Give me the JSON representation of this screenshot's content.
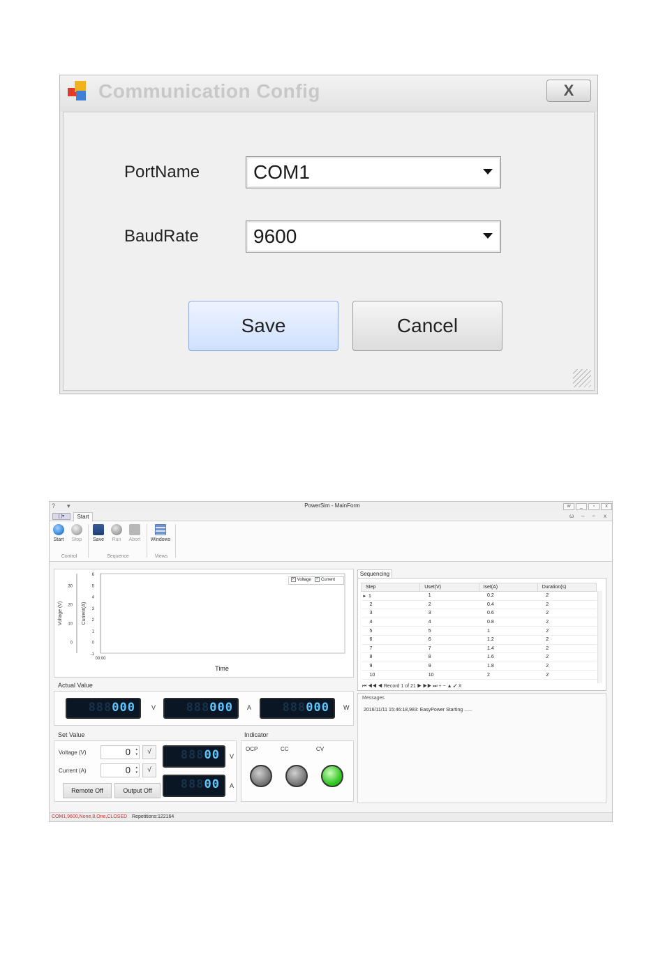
{
  "dialog": {
    "title": "Communication Config",
    "close_label": "X",
    "port_label": "PortName",
    "port_value": "COM1",
    "baud_label": "BaudRate",
    "baud_value": "9600",
    "save_label": "Save",
    "cancel_label": "Cancel"
  },
  "window": {
    "title": "PowerSim - MainForm",
    "qa_help": "?",
    "qa_dropdown": "▾",
    "controls": [
      "w",
      "_",
      "▫",
      "x"
    ],
    "tab": "Start",
    "app_button": "[ ]▾",
    "minimize_ribbon": "ω",
    "small_controls": [
      "–",
      "▫",
      "x"
    ]
  },
  "ribbon": {
    "buttons": [
      "Start",
      "Stop",
      "Save",
      "Run",
      "Abort",
      "Windows"
    ],
    "groups": [
      "Control",
      "Sequence",
      "Views"
    ]
  },
  "chart": {
    "legend_voltage": "Voltage",
    "legend_current": "Current",
    "check": "✓"
  },
  "chart_data": {
    "type": "line",
    "title": "",
    "xlabel": "Time",
    "ylabel": "Voltage (V)",
    "y2label": "Current(A)",
    "x_ticks": [
      "00:00"
    ],
    "y_ticks": [
      "30",
      "20",
      "10",
      "0"
    ],
    "y2_ticks": [
      "6",
      "5",
      "4",
      "3",
      "2",
      "1",
      "0",
      "-1"
    ],
    "ylim": [
      0,
      30
    ],
    "y2lim": [
      -1,
      6
    ],
    "legend": "top-right",
    "series": [
      {
        "name": "Voltage",
        "values": []
      },
      {
        "name": "Current",
        "values": []
      }
    ]
  },
  "actual": {
    "label": "Actual Value",
    "ghost": "888",
    "value": "000",
    "units": [
      "V",
      "A",
      "W"
    ]
  },
  "setvalue": {
    "label": "Set Value",
    "voltage_label": "Voltage (V)",
    "current_label": "Current (A)",
    "voltage_value": "0",
    "current_value": "0",
    "apply": "√",
    "ghost": "888",
    "value": "00",
    "units": [
      "V",
      "A"
    ],
    "remote_off": "Remote Off",
    "output_off": "Output Off",
    "spin_up": "▴",
    "spin_down": "▾"
  },
  "indicator": {
    "label": "Indicator",
    "labels": [
      "OCP",
      "CC",
      "CV"
    ]
  },
  "sequencing": {
    "tab": "Sequencing",
    "columns": [
      "Step",
      "Uset(V)",
      "Iset(A)",
      "Duration(s)"
    ],
    "rows": [
      [
        "1",
        "1",
        "0.2",
        "2"
      ],
      [
        "2",
        "2",
        "0.4",
        "2"
      ],
      [
        "3",
        "3",
        "0.6",
        "2"
      ],
      [
        "4",
        "4",
        "0.8",
        "2"
      ],
      [
        "5",
        "5",
        "1",
        "2"
      ],
      [
        "6",
        "6",
        "1.2",
        "2"
      ],
      [
        "7",
        "7",
        "1.4",
        "2"
      ],
      [
        "8",
        "8",
        "1.6",
        "2"
      ],
      [
        "9",
        "9",
        "1.8",
        "2"
      ],
      [
        "10",
        "10",
        "2",
        "2"
      ]
    ],
    "pager": "⏮ ◀◀ ◀  Record 1 of 21  ▶ ▶▶ ⏭ + − ▲ ✓ X",
    "row_marker": "▸"
  },
  "messages": {
    "label": "Messages",
    "lines": [
      "2016/11/11 15:46:18,983: EasyPower Starting ......"
    ]
  },
  "status": {
    "connection": "COM1,9600,None,8,One,CLOSED",
    "repetitions": "Repetitions:122164"
  },
  "colors": {
    "lcd_lit": "#5fc6ff",
    "lcd_bg": "#0a1624",
    "status_red": "#d23030",
    "led_green": "#2ec21e"
  }
}
